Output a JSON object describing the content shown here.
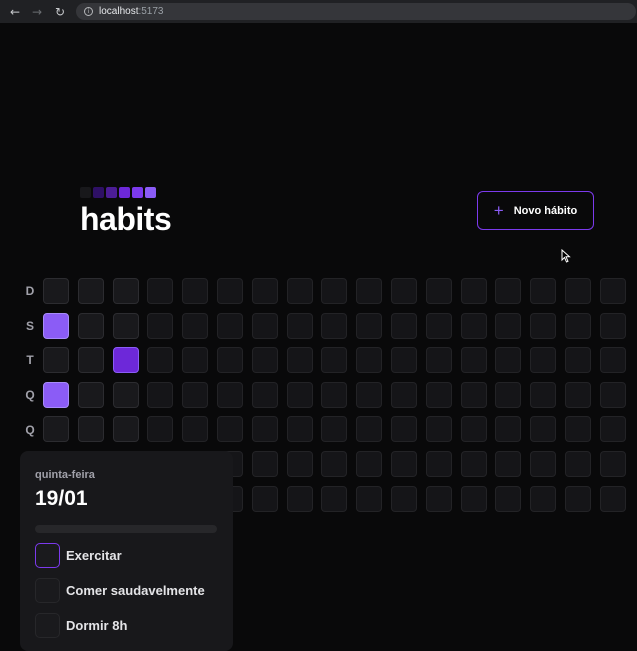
{
  "browser": {
    "url_host": "localhost",
    "url_port": ":5173",
    "back_glyph": "←",
    "forward_glyph": "→",
    "reload_glyph": "↻",
    "info_glyph": "i"
  },
  "logo": {
    "text": "habits",
    "squares": [
      "#18181b",
      "#2e1065",
      "#4c1d95",
      "#6d28d9",
      "#7c3aed",
      "#8b5cf6"
    ]
  },
  "header": {
    "new_habit_label": "Novo hábito",
    "plus_glyph": "+"
  },
  "weekdays": [
    "D",
    "S",
    "T",
    "Q",
    "Q"
  ],
  "summary_grid": {
    "columns": 17,
    "rows": 7,
    "days": [
      [
        "past",
        "past",
        "past"
      ],
      [
        "lvl3",
        "past",
        "past"
      ],
      [
        "past",
        "past",
        "lvl2"
      ],
      [
        "lvl3",
        "past",
        "past"
      ],
      [
        "past",
        "past",
        "past"
      ]
    ]
  },
  "popover": {
    "weekday": "quinta-feira",
    "date": "19/01",
    "completed_fraction": 0,
    "habits": [
      {
        "label": "Exercitar",
        "checked": false,
        "focused": true
      },
      {
        "label": "Comer saudavelmente",
        "checked": false,
        "focused": false
      },
      {
        "label": "Dormir 8h",
        "checked": false,
        "focused": false
      }
    ]
  },
  "colors": {
    "accent": "#8b5cf6",
    "accent_dark": "#7c3aed",
    "background": "#09090a"
  }
}
